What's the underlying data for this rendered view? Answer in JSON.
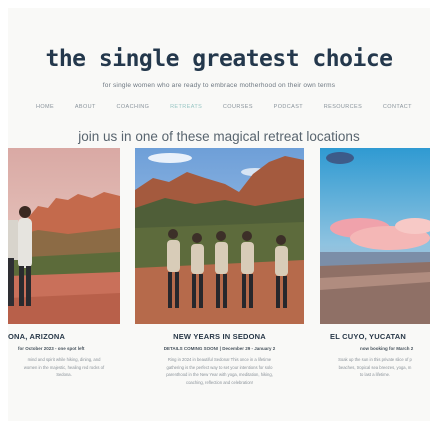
{
  "header": {
    "title": "the single greatest choice",
    "tagline": "for single women who are ready to embrace motherhood on their own terms"
  },
  "nav": {
    "items": [
      {
        "label": "HOME"
      },
      {
        "label": "ABOUT"
      },
      {
        "label": "COACHING"
      },
      {
        "label": "RETREATS"
      },
      {
        "label": "COURSES"
      },
      {
        "label": "PODCAST"
      },
      {
        "label": "RESOURCES"
      },
      {
        "label": "CONTACT"
      }
    ],
    "active_color": "#98c6c4"
  },
  "main": {
    "subheading": "join us in one of these magical retreat locations",
    "cards": [
      {
        "title": "ONA, ARIZONA",
        "meta": "for October 2023 - one spot left",
        "desc": [
          "mind and spirit while hiking, dining, and",
          "women in the majestic, healing red rocks of",
          "Sedona."
        ]
      },
      {
        "title": "NEW YEARS IN SEDONA",
        "meta": "DETAILS COMING SOON! | December 29 - January 2",
        "desc": [
          "Ring in 2024 in beautiful Sedona! This once in a lifetime",
          "gathering is the perfect way to set your intentions for solo",
          "parenthood in the New Year with yoga, meditation, hiking,",
          "coaching, reflection and celebration!"
        ]
      },
      {
        "title": "EL CUYO, YUCATAN",
        "meta": "now booking for March 2",
        "desc": [
          "Soak up the sun in this private slice of p",
          "beaches, tropical sea breezes, yoga, m",
          "to last a lifetime."
        ]
      }
    ]
  },
  "colors": {
    "title": "#24384c",
    "background": "#f9f9f7"
  }
}
